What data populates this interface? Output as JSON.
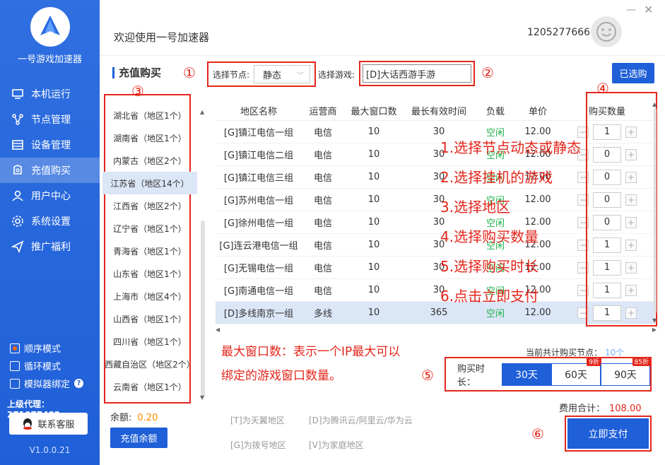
{
  "sidebar": {
    "brand": "一号游戏加速器",
    "items": [
      {
        "label": "本机运行",
        "icon": "monitor-icon"
      },
      {
        "label": "节点管理",
        "icon": "network-icon"
      },
      {
        "label": "设备管理",
        "icon": "device-icon"
      },
      {
        "label": "充值购买",
        "icon": "wallet-icon"
      },
      {
        "label": "用户中心",
        "icon": "user-icon"
      },
      {
        "label": "系统设置",
        "icon": "gear-icon"
      },
      {
        "label": "推广福利",
        "icon": "send-icon"
      }
    ],
    "modes": [
      "顺序模式",
      "循环模式",
      "模拟器绑定"
    ],
    "agent": "上级代理：271077482",
    "support": "联系客服",
    "version": "V1.0.0.21"
  },
  "header": {
    "welcome": "欢迎使用一号加速器",
    "user_id": "1205277666"
  },
  "purchase": {
    "title": "充值购买",
    "node_label": "选择节点:",
    "node_value": "静态",
    "game_label": "选择游戏:",
    "game_value": "[D]大话西游手游",
    "selected_btn": "已选购",
    "regions": [
      "湖北省（地区1个）",
      "湖南省（地区1个）",
      "内蒙古（地区2个）",
      "江苏省（地区14个）",
      "江西省（地区2个）",
      "辽宁省（地区1个）",
      "青海省（地区1个）",
      "山东省（地区1个）",
      "上海市（地区4个）",
      "山西省（地区1个）",
      "四川省（地区1个）",
      "西藏自治区（地区2个）",
      "云南省（地区1个）"
    ],
    "balance_label": "余额:",
    "balance_value": "0.20",
    "recharge_btn": "充值余额",
    "table_headers": [
      "地区名称",
      "运营商",
      "最大窗口数",
      "最长有效时间",
      "负载",
      "单价",
      "购买数量"
    ],
    "rows": [
      {
        "name": "[G]镇江电信一组",
        "isp": "电信",
        "win": "10",
        "days": "30",
        "load": "空闲",
        "price": "12.00",
        "qty": "1"
      },
      {
        "name": "[G]镇江电信二组",
        "isp": "电信",
        "win": "10",
        "days": "30",
        "load": "空闲",
        "price": "12.00",
        "qty": "0"
      },
      {
        "name": "[G]镇江电信三组",
        "isp": "电信",
        "win": "10",
        "days": "30",
        "load": "空闲",
        "price": "12.00",
        "qty": "0"
      },
      {
        "name": "[G]苏州电信一组",
        "isp": "电信",
        "win": "10",
        "days": "30",
        "load": "空闲",
        "price": "12.00",
        "qty": "0"
      },
      {
        "name": "[G]徐州电信一组",
        "isp": "电信",
        "win": "10",
        "days": "30",
        "load": "空闲",
        "price": "12.00",
        "qty": "0"
      },
      {
        "name": "[G]连云港电信一组",
        "isp": "电信",
        "win": "10",
        "days": "30",
        "load": "空闲",
        "price": "12.00",
        "qty": "1"
      },
      {
        "name": "[G]无锡电信一组",
        "isp": "电信",
        "win": "10",
        "days": "30",
        "load": "空闲",
        "price": "12.00",
        "qty": "1"
      },
      {
        "name": "[G]南通电信一组",
        "isp": "电信",
        "win": "10",
        "days": "30",
        "load": "空闲",
        "price": "12.00",
        "qty": "1"
      },
      {
        "name": "[D]多线南京一组",
        "isp": "多线",
        "win": "10",
        "days": "365",
        "load": "空闲",
        "price": "12.00",
        "qty": "1"
      }
    ],
    "steps": [
      "1.选择节点动态或静态",
      "2.选择挂机的游戏",
      "3.选择地区",
      "4.选择购买数量",
      "5.选择购买时长",
      "6.点击立即支付"
    ],
    "note_line1": "最大窗口数：表示一个IP最大可以",
    "note_line2": "绑定的游戏窗口数量。",
    "total_nodes_label": "当前共计购买节点：",
    "total_nodes_value": "10个",
    "duration_label": "购买时长：",
    "durations": [
      {
        "label": "30天",
        "badge": ""
      },
      {
        "label": "60天",
        "badge": "9折"
      },
      {
        "label": "90天",
        "badge": "85折"
      }
    ],
    "fee_label": "费用合计：",
    "fee_value": "108.00",
    "pay_btn": "立即支付",
    "legend": [
      "[T]为天翼地区",
      "[D]为腾讯云/阿里云/华为云",
      "[G]为拨号地区",
      "[V]为家庭地区"
    ],
    "circled": [
      "①",
      "②",
      "③",
      "④",
      "⑤",
      "⑥"
    ]
  }
}
